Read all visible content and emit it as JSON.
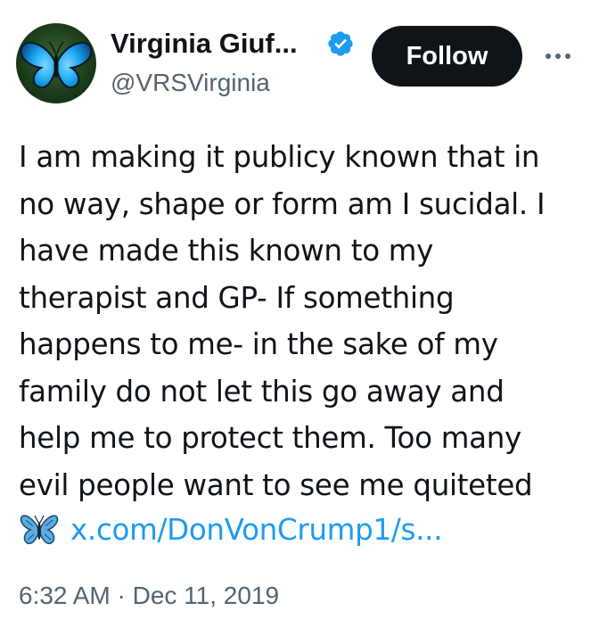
{
  "author": {
    "display_name": "Virginia Giuf...",
    "handle": "@VRSVirginia",
    "verified_icon": "verified-badge-icon",
    "avatar_icon": "blue-butterfly-avatar"
  },
  "actions": {
    "follow_label": "Follow",
    "more_icon": "more-options-icon"
  },
  "tweet": {
    "lines": [
      "I am making it publicy known that in",
      "no way, shape or form am I sucidal. I",
      "have made this known to my",
      "therapist and GP- If something",
      "happens to me- in the sake of my",
      "family do not let this go away and",
      "help me to protect them. Too many",
      "evil people want to see me quiteted"
    ],
    "emoji_icon": "butterfly-emoji-icon",
    "link_text": "x.com/DonVonCrump1/s..."
  },
  "meta": {
    "timestamp": "6:32 AM · Dec 11, 2019"
  },
  "colors": {
    "text_primary": "#0f1419",
    "text_secondary": "#536471",
    "link": "#1d9bf0",
    "follow_button_bg": "#0f1419",
    "verified_blue": "#1d9bf0"
  }
}
